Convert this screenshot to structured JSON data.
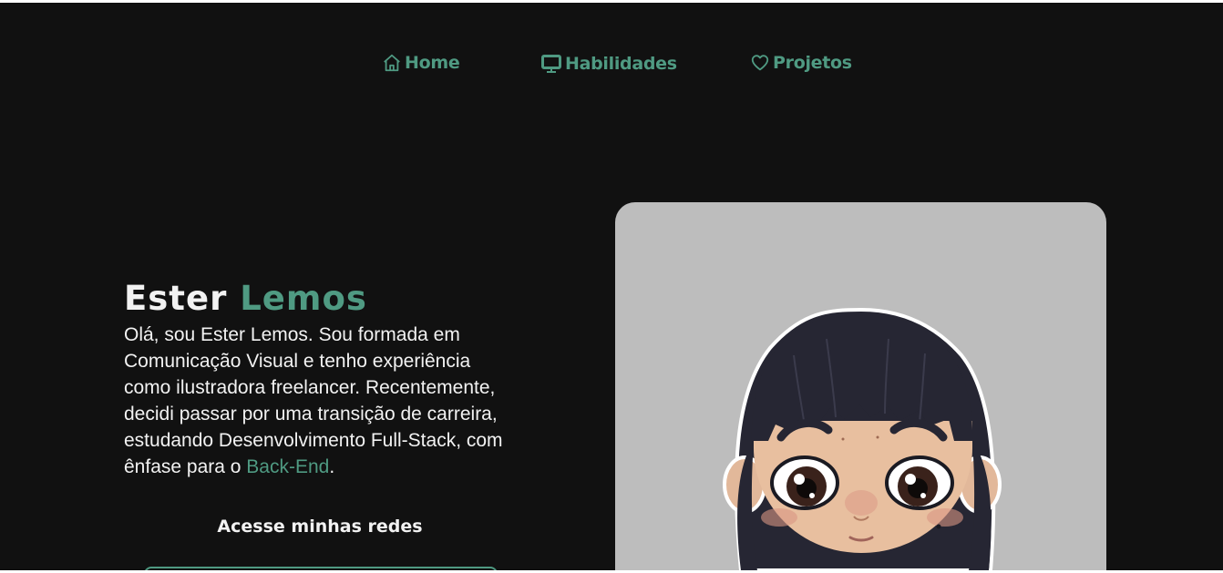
{
  "nav": {
    "items": [
      {
        "label": "Home",
        "icon": "home-icon"
      },
      {
        "label": "Habilidades",
        "icon": "monitor-icon"
      },
      {
        "label": "Projetos",
        "icon": "heart-icon"
      }
    ]
  },
  "hero": {
    "first_name": "Ester",
    "last_name": "Lemos",
    "bio_main": "Olá, sou Ester Lemos. Sou formada em Comunicação Visual e tenho experiência como ilustradora freelancer. Recentemente, decidi passar por uma transição de carreira, estudando Desenvolvimento Full-Stack, com ênfase para o ",
    "bio_highlight": "Back-End",
    "bio_end": "."
  },
  "social": {
    "heading": "Acesse minhas redes"
  },
  "colors": {
    "background": "#111111",
    "accent": "#4f9a82",
    "text": "#f2f2f2",
    "card": "#bdbdbd"
  }
}
